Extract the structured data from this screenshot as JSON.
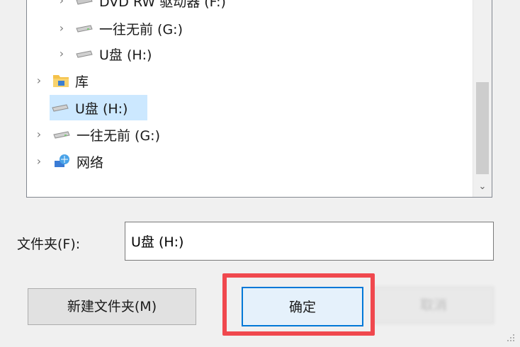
{
  "tree": {
    "items": [
      {
        "label": "DVD RW 驱动器 (F:)",
        "icon": "dvd-drive-icon"
      },
      {
        "label": "一往无前 (G:)",
        "icon": "drive-icon"
      },
      {
        "label": "U盘 (H:)",
        "icon": "usb-drive-icon"
      },
      {
        "label": "库",
        "icon": "library-folder-icon"
      },
      {
        "label": "U盘 (H:)",
        "icon": "usb-drive-icon",
        "selected": true
      },
      {
        "label": "一往无前 (G:)",
        "icon": "drive-icon"
      },
      {
        "label": "网络",
        "icon": "network-icon"
      }
    ]
  },
  "folder": {
    "label": "文件夹(F):",
    "value": "U盘 (H:)"
  },
  "buttons": {
    "new_folder": "新建文件夹(M)",
    "ok": "确定",
    "cancel": "取消"
  },
  "colors": {
    "highlight": "#f0484e",
    "selection": "#cce8ff",
    "focus": "#0078d7"
  }
}
